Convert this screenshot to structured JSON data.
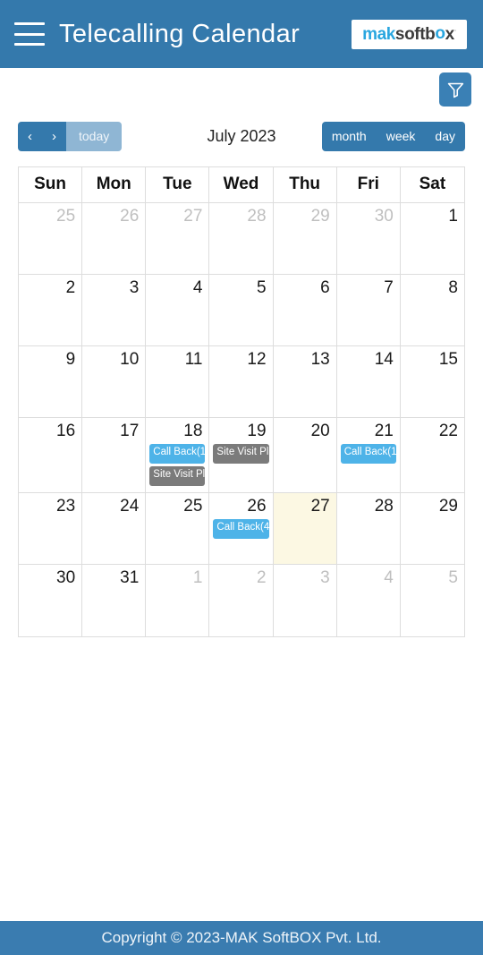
{
  "appbar": {
    "menu_icon": "hamburger-menu-icon",
    "title": "Telecalling Calendar",
    "logo": {
      "part1": "mak",
      "part2": "softb",
      "part3": "o",
      "part4": "x",
      "tm": "·"
    }
  },
  "filter": {
    "icon": "funnel-filter-icon",
    "label": "Filter"
  },
  "toolbar": {
    "prev_label": "‹",
    "next_label": "›",
    "today_label": "today",
    "title": "July 2023",
    "views": [
      {
        "label": "month",
        "active": true
      },
      {
        "label": "week",
        "active": false
      },
      {
        "label": "day",
        "active": false
      }
    ]
  },
  "calendar": {
    "weekdays": [
      "Sun",
      "Mon",
      "Tue",
      "Wed",
      "Thu",
      "Fri",
      "Sat"
    ],
    "weeks": [
      [
        {
          "day": "25",
          "other": true,
          "today": false,
          "events": []
        },
        {
          "day": "26",
          "other": true,
          "today": false,
          "events": []
        },
        {
          "day": "27",
          "other": true,
          "today": false,
          "events": []
        },
        {
          "day": "28",
          "other": true,
          "today": false,
          "events": []
        },
        {
          "day": "29",
          "other": true,
          "today": false,
          "events": []
        },
        {
          "day": "30",
          "other": true,
          "today": false,
          "events": []
        },
        {
          "day": "1",
          "other": false,
          "today": false,
          "events": []
        }
      ],
      [
        {
          "day": "2",
          "other": false,
          "today": false,
          "events": []
        },
        {
          "day": "3",
          "other": false,
          "today": false,
          "events": []
        },
        {
          "day": "4",
          "other": false,
          "today": false,
          "events": []
        },
        {
          "day": "5",
          "other": false,
          "today": false,
          "events": []
        },
        {
          "day": "6",
          "other": false,
          "today": false,
          "events": []
        },
        {
          "day": "7",
          "other": false,
          "today": false,
          "events": []
        },
        {
          "day": "8",
          "other": false,
          "today": false,
          "events": []
        }
      ],
      [
        {
          "day": "9",
          "other": false,
          "today": false,
          "events": []
        },
        {
          "day": "10",
          "other": false,
          "today": false,
          "events": []
        },
        {
          "day": "11",
          "other": false,
          "today": false,
          "events": []
        },
        {
          "day": "12",
          "other": false,
          "today": false,
          "events": []
        },
        {
          "day": "13",
          "other": false,
          "today": false,
          "events": []
        },
        {
          "day": "14",
          "other": false,
          "today": false,
          "events": []
        },
        {
          "day": "15",
          "other": false,
          "today": false,
          "events": []
        }
      ],
      [
        {
          "day": "16",
          "other": false,
          "today": false,
          "events": []
        },
        {
          "day": "17",
          "other": false,
          "today": false,
          "events": []
        },
        {
          "day": "18",
          "other": false,
          "today": false,
          "events": [
            {
              "text": "Call Back(1",
              "type": "callback"
            },
            {
              "text": "Site Visit Pl",
              "type": "sitevisit"
            }
          ]
        },
        {
          "day": "19",
          "other": false,
          "today": false,
          "events": [
            {
              "text": "Site Visit Pl",
              "type": "sitevisit"
            }
          ]
        },
        {
          "day": "20",
          "other": false,
          "today": false,
          "events": []
        },
        {
          "day": "21",
          "other": false,
          "today": false,
          "events": [
            {
              "text": "Call Back(1",
              "type": "callback"
            }
          ]
        },
        {
          "day": "22",
          "other": false,
          "today": false,
          "events": []
        }
      ],
      [
        {
          "day": "23",
          "other": false,
          "today": false,
          "events": []
        },
        {
          "day": "24",
          "other": false,
          "today": false,
          "events": []
        },
        {
          "day": "25",
          "other": false,
          "today": false,
          "events": []
        },
        {
          "day": "26",
          "other": false,
          "today": false,
          "events": [
            {
              "text": "Call Back(4",
              "type": "callback"
            }
          ]
        },
        {
          "day": "27",
          "other": false,
          "today": true,
          "events": []
        },
        {
          "day": "28",
          "other": false,
          "today": false,
          "events": []
        },
        {
          "day": "29",
          "other": false,
          "today": false,
          "events": []
        }
      ],
      [
        {
          "day": "30",
          "other": false,
          "today": false,
          "events": []
        },
        {
          "day": "31",
          "other": false,
          "today": false,
          "events": []
        },
        {
          "day": "1",
          "other": true,
          "today": false,
          "events": []
        },
        {
          "day": "2",
          "other": true,
          "today": false,
          "events": []
        },
        {
          "day": "3",
          "other": true,
          "today": false,
          "events": []
        },
        {
          "day": "4",
          "other": true,
          "today": false,
          "events": []
        },
        {
          "day": "5",
          "other": true,
          "today": false,
          "events": []
        }
      ]
    ]
  },
  "footer": {
    "text": "Copyright © 2023-MAK SoftBOX Pvt. Ltd."
  },
  "colors": {
    "header_blue": "#3479ac",
    "footer_blue": "#3a7cb0",
    "callback_blue": "#4eb3e8",
    "sitevisit_gray": "#7b7b7b",
    "today_cream": "#fcf8e3",
    "today_btn_disabled": "#8fb6d4"
  }
}
